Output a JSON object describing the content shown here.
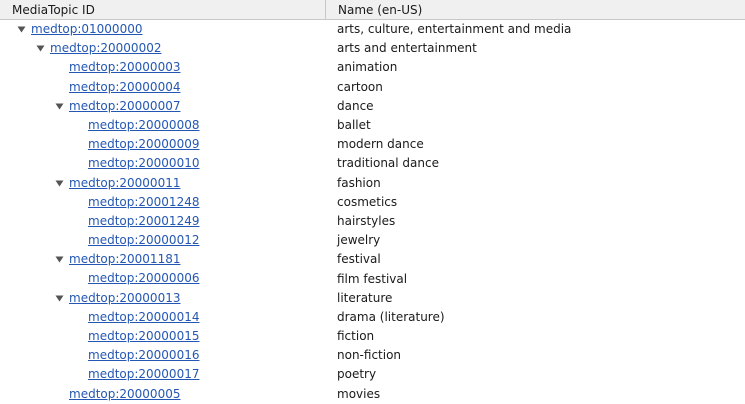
{
  "columns": {
    "id_header": "MediaTopic ID",
    "name_header": "Name (en-US)"
  },
  "colors": {
    "link": "#2457b3",
    "toggle": "#555555",
    "header_bg": "#f0f0f0"
  },
  "rows": [
    {
      "id": "medtop:01000000",
      "name": "arts, culture, entertainment and media",
      "level": 0,
      "expandable": true,
      "expanded": true
    },
    {
      "id": "medtop:20000002",
      "name": "arts and entertainment",
      "level": 1,
      "expandable": true,
      "expanded": true
    },
    {
      "id": "medtop:20000003",
      "name": "animation",
      "level": 2,
      "expandable": false
    },
    {
      "id": "medtop:20000004",
      "name": "cartoon",
      "level": 2,
      "expandable": false
    },
    {
      "id": "medtop:20000007",
      "name": "dance",
      "level": 2,
      "expandable": true,
      "expanded": true
    },
    {
      "id": "medtop:20000008",
      "name": "ballet",
      "level": 3,
      "expandable": false
    },
    {
      "id": "medtop:20000009",
      "name": "modern dance",
      "level": 3,
      "expandable": false
    },
    {
      "id": "medtop:20000010",
      "name": "traditional dance",
      "level": 3,
      "expandable": false
    },
    {
      "id": "medtop:20000011",
      "name": "fashion",
      "level": 2,
      "expandable": true,
      "expanded": true
    },
    {
      "id": "medtop:20001248",
      "name": "cosmetics",
      "level": 3,
      "expandable": false
    },
    {
      "id": "medtop:20001249",
      "name": "hairstyles",
      "level": 3,
      "expandable": false
    },
    {
      "id": "medtop:20000012",
      "name": "jewelry",
      "level": 3,
      "expandable": false
    },
    {
      "id": "medtop:20001181",
      "name": "festival",
      "level": 2,
      "expandable": true,
      "expanded": true
    },
    {
      "id": "medtop:20000006",
      "name": "film festival",
      "level": 3,
      "expandable": false
    },
    {
      "id": "medtop:20000013",
      "name": "literature",
      "level": 2,
      "expandable": true,
      "expanded": true
    },
    {
      "id": "medtop:20000014",
      "name": "drama (literature)",
      "level": 3,
      "expandable": false
    },
    {
      "id": "medtop:20000015",
      "name": "fiction",
      "level": 3,
      "expandable": false
    },
    {
      "id": "medtop:20000016",
      "name": "non-fiction",
      "level": 3,
      "expandable": false
    },
    {
      "id": "medtop:20000017",
      "name": "poetry",
      "level": 3,
      "expandable": false
    },
    {
      "id": "medtop:20000005",
      "name": "movies",
      "level": 2,
      "expandable": false
    }
  ]
}
